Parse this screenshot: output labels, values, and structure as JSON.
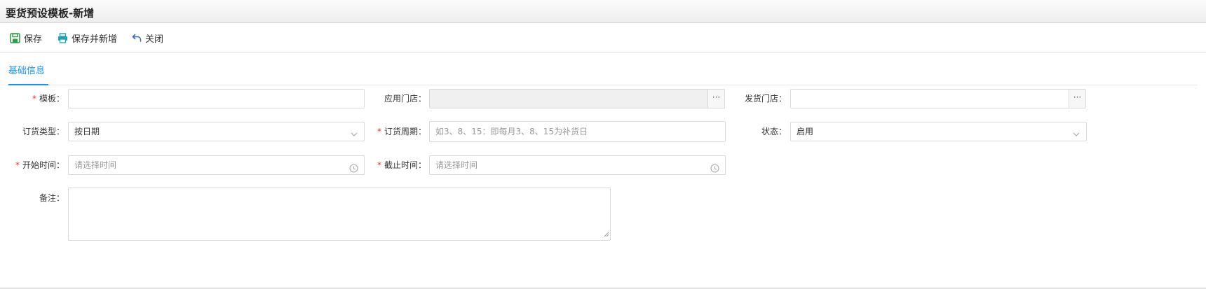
{
  "page": {
    "title": "要货预设模板-新增"
  },
  "toolbar": {
    "save": "保存",
    "save_and_new": "保存并新增",
    "close": "关闭"
  },
  "tabs": [
    {
      "label": "基础信息",
      "active": true
    }
  ],
  "form": {
    "template": {
      "label": "模板：",
      "required": true,
      "value": ""
    },
    "apply_store": {
      "label": "应用门店：",
      "value": "",
      "disabled": true,
      "addon": "···"
    },
    "ship_store": {
      "label": "发货门店：",
      "value": "",
      "addon": "···"
    },
    "order_type": {
      "label": "订货类型：",
      "value": "按日期"
    },
    "order_cycle": {
      "label": "订货周期：",
      "required": true,
      "placeholder": "如3、8、15：即每月3、8、15为补货日"
    },
    "status": {
      "label": "状态：",
      "value": "启用"
    },
    "start_time": {
      "label": "开始时间：",
      "required": true,
      "placeholder": "请选择时间"
    },
    "end_time": {
      "label": "截止时间：",
      "required": true,
      "placeholder": "请选择时间"
    },
    "remark": {
      "label": "备注：",
      "value": ""
    },
    "required_mark": "*"
  },
  "colors": {
    "accent": "#1890ff",
    "required": "#ee3333",
    "save_icon": "#2e9e44",
    "print_icon": "#1ba3b8",
    "close_icon": "#3b6db3"
  }
}
